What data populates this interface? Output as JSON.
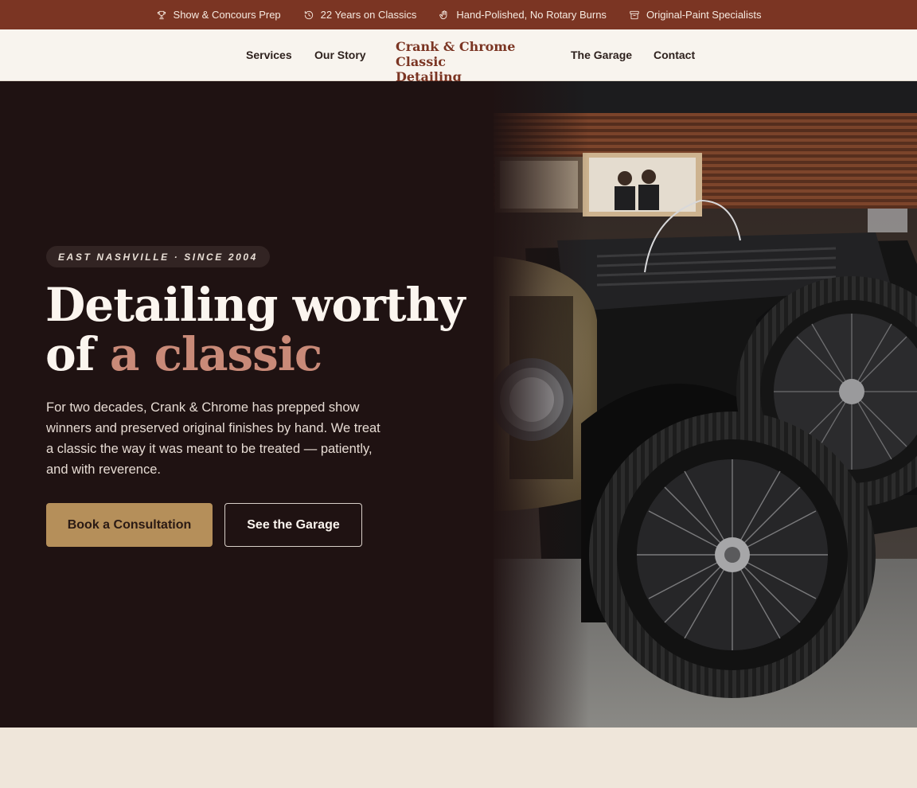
{
  "topbar": {
    "items": [
      {
        "label": "Show & Concours Prep",
        "icon": "trophy-icon"
      },
      {
        "label": "22 Years on Classics",
        "icon": "history-clock-icon"
      },
      {
        "label": "Hand-Polished, No Rotary Burns",
        "icon": "hand-icon"
      },
      {
        "label": "Original-Paint Specialists",
        "icon": "archive-box-icon"
      }
    ]
  },
  "nav": {
    "links": [
      "Services",
      "Our Story",
      "The Garage",
      "Contact"
    ],
    "logo_line1": "Crank & Chrome Classic",
    "logo_line2": "Detailing"
  },
  "hero": {
    "eyebrow": "EAST NASHVILLE · SINCE 2004",
    "headline_part1": "Detailing worthy",
    "headline_part2": "of ",
    "headline_accent": "a classic",
    "lede": "For two decades, Crank & Chrome has prepped show winners and preserved original finishes by hand. We treat a classic the way it was meant to be treated — patiently, and with reverence.",
    "primary_cta": "Book a Consultation",
    "secondary_cta": "See the Garage",
    "image_alt": "Vintage black open-top classic car with wire wheels in a garage"
  },
  "colors": {
    "topbar": "#7b3523",
    "nav_bg": "#f8f4ee",
    "hero_bg": "#1f1212",
    "accent_text": "#c98a78",
    "primary_button": "#b58f5a",
    "page_bg": "#efe6da"
  }
}
